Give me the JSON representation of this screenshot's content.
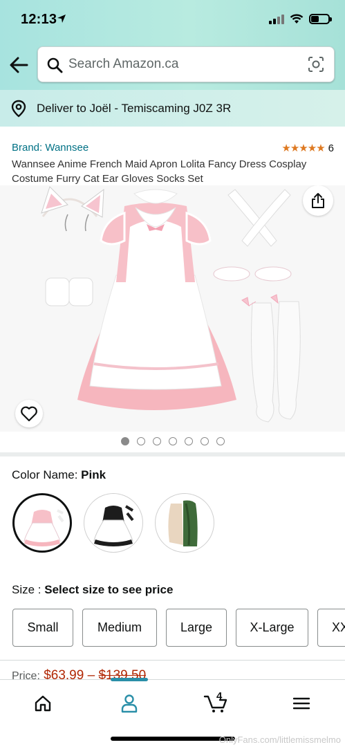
{
  "status_bar": {
    "time": "12:13"
  },
  "search": {
    "placeholder": "Search Amazon.ca"
  },
  "delivery": {
    "text": "Deliver to Joël - Temiscaming J0Z 3R"
  },
  "product": {
    "brand": "Brand: Wannsee",
    "rating_stars": "★★★★★",
    "rating_value": 4.5,
    "rating_count": "6",
    "title": "Wannsee Anime French Maid Apron Lolita Fancy Dress Cosplay Costume Furry Cat Ear Gloves Socks Set",
    "image_count": 7,
    "active_image_index": 0
  },
  "color": {
    "label": "Color Name: ",
    "selected": "Pink",
    "options": [
      "Pink",
      "Black",
      "Green"
    ]
  },
  "size": {
    "label": "Size : ",
    "prompt": "Select size to see price",
    "options": [
      "Small",
      "Medium",
      "Large",
      "X-Large",
      "XX"
    ]
  },
  "price": {
    "label": "Price:",
    "current": "$63.99",
    "list": "$139.50"
  },
  "bottom_nav": {
    "cart_count": "4",
    "active_tab": "profile"
  },
  "watermark": "OnlyFans.com/littlemissmelmo",
  "colors": {
    "accent": "#2a8fa8",
    "link": "#007185",
    "star": "#de7921",
    "price": "#b12704",
    "header_start": "#a7e3df",
    "header_end": "#a6e1d8"
  }
}
